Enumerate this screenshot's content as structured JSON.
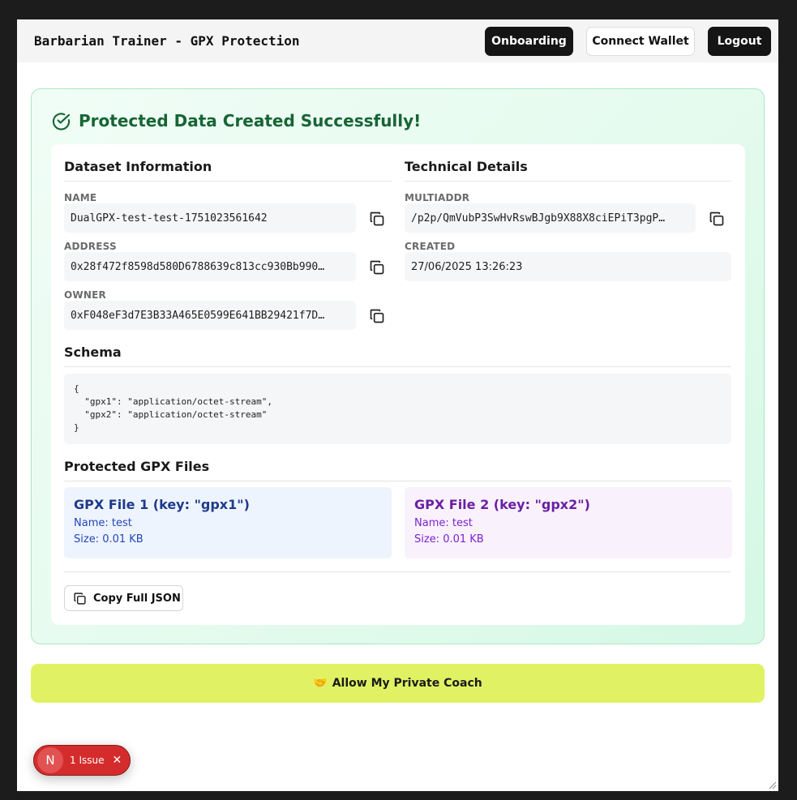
{
  "header": {
    "brand": "Barbarian Trainer - GPX Protection",
    "onboarding_label": "Onboarding",
    "connect_wallet_label": "Connect Wallet",
    "logout_label": "Logout"
  },
  "success": {
    "title": "Protected Data Created Successfully!"
  },
  "dataset": {
    "section_title": "Dataset Information",
    "name_label": "NAME",
    "name_value": "DualGPX-test-test-1751023561642",
    "address_label": "ADDRESS",
    "address_value": "0x28f472f8598d580D6788639c813cc930Bb990…",
    "owner_label": "OWNER",
    "owner_value": "0xF048eF3d7E3B33A465E0599E641BB29421f7D…"
  },
  "technical": {
    "section_title": "Technical Details",
    "multiaddr_label": "MULTIADDR",
    "multiaddr_value": "/p2p/QmVubP3SwHvRswBJgb9X88X8ciEPiT3pgP…",
    "created_label": "CREATED",
    "created_value": "27/06/2025 13:26:23"
  },
  "schema": {
    "section_title": "Schema",
    "body": "{\n  \"gpx1\": \"application/octet-stream\",\n  \"gpx2\": \"application/octet-stream\"\n}"
  },
  "files": {
    "section_title": "Protected GPX Files",
    "items": [
      {
        "title": "GPX File 1 (key: \"gpx1\")",
        "name": "Name: test",
        "size": "Size: 0.01 KB"
      },
      {
        "title": "GPX File 2 (key: \"gpx2\")",
        "name": "Name: test",
        "size": "Size: 0.01 KB"
      }
    ],
    "copy_json_label": "Copy Full JSON"
  },
  "coach": {
    "emoji": "🤝",
    "label": "Allow My Private Coach"
  },
  "issue_badge": {
    "logo": "N",
    "label": "1 Issue",
    "close": "✕"
  },
  "icons": {
    "success": "check-circle-icon",
    "copy": "copy-icon",
    "close": "close-icon"
  },
  "colors": {
    "success_green": "#166534",
    "coach_yellow": "#e0f263",
    "issue_red": "#d42c2c",
    "dark_button": "#151515"
  }
}
